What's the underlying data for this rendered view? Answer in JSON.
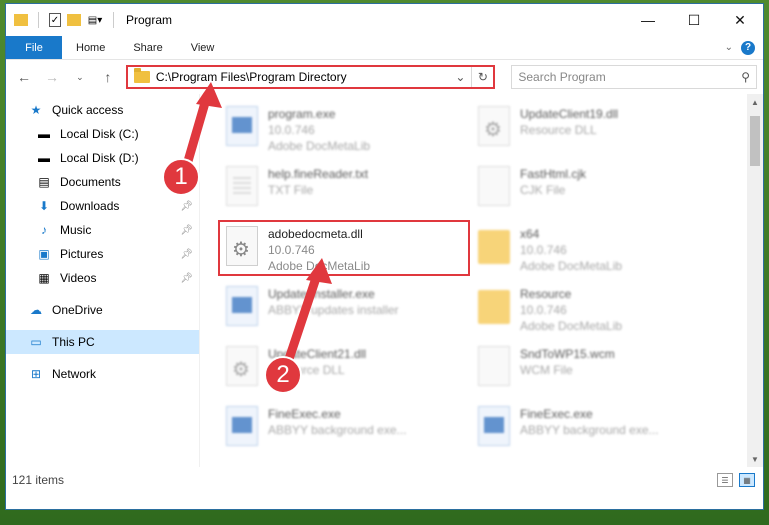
{
  "window": {
    "title": "Program"
  },
  "ribbon": {
    "file": "File",
    "tabs": [
      "Home",
      "Share",
      "View"
    ]
  },
  "address": {
    "path": "C:\\Program Files\\Program Directory"
  },
  "search": {
    "placeholder": "Search Program"
  },
  "sidebar": {
    "items": [
      {
        "label": "Quick access",
        "icon": "star-icon"
      },
      {
        "label": "Local Disk (C:)",
        "icon": "disk-icon"
      },
      {
        "label": "Local Disk (D:)",
        "icon": "disk-icon"
      },
      {
        "label": "Documents",
        "icon": "documents-icon"
      },
      {
        "label": "Downloads",
        "icon": "download-icon"
      },
      {
        "label": "Music",
        "icon": "music-icon"
      },
      {
        "label": "Pictures",
        "icon": "pictures-icon"
      },
      {
        "label": "Videos",
        "icon": "videos-icon"
      },
      {
        "label": "OneDrive",
        "icon": "cloud-icon"
      },
      {
        "label": "This PC",
        "icon": "computer-icon"
      },
      {
        "label": "Network",
        "icon": "network-icon"
      }
    ]
  },
  "files": [
    {
      "name": "program.exe",
      "line2": "10.0.746",
      "line3": "Adobe DocMetaLib"
    },
    {
      "name": "UpdateClient19.dll",
      "line2": "Resource DLL",
      "line3": ""
    },
    {
      "name": "help.fineReader.txt",
      "line2": "TXT File",
      "line3": ""
    },
    {
      "name": "FastHtml.cjk",
      "line2": "CJK File",
      "line3": ""
    },
    {
      "name": "adobedocmeta.dll",
      "line2": "10.0.746",
      "line3": "Adobe DocMetaLib"
    },
    {
      "name": "x64",
      "line2": "10.0.746",
      "line3": "Adobe DocMetaLib"
    },
    {
      "name": "UpdaterInstaller.exe",
      "line2": "ABBYY updates installer",
      "line3": ""
    },
    {
      "name": "Resource",
      "line2": "10.0.746",
      "line3": "Adobe DocMetaLib"
    },
    {
      "name": "UpdateClient21.dll",
      "line2": "Resource DLL",
      "line3": ""
    },
    {
      "name": "SndToWP15.wcm",
      "line2": "WCM File",
      "line3": ""
    },
    {
      "name": "FineExec.exe",
      "line2": "ABBYY background exe...",
      "line3": ""
    },
    {
      "name": "FineExec.exe",
      "line2": "ABBYY background exe...",
      "line3": ""
    }
  ],
  "status": {
    "items": "121 items"
  },
  "callouts": {
    "one": "1",
    "two": "2"
  },
  "colors": {
    "accent": "#1979ca",
    "highlight": "#e0383e",
    "selected": "#cce8ff"
  }
}
